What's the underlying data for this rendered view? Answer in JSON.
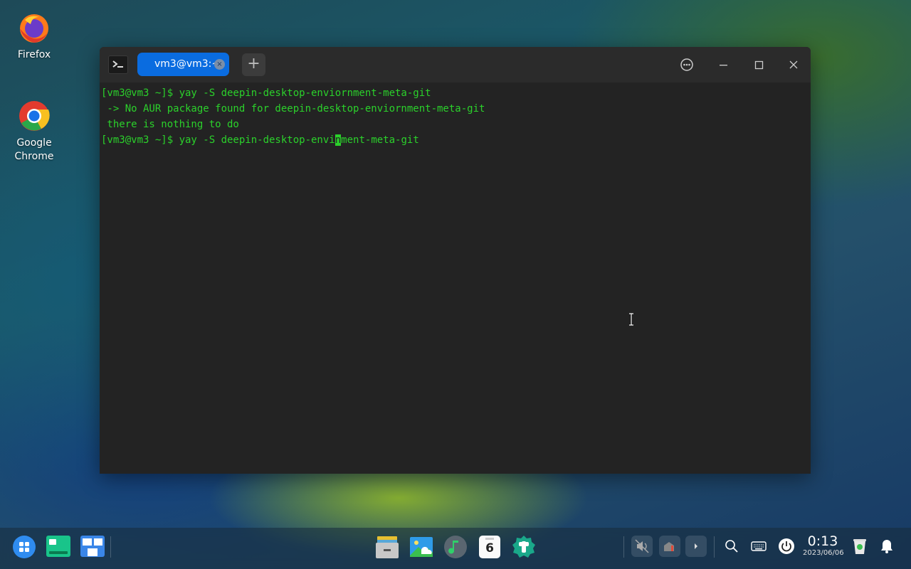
{
  "desktop": {
    "icons": [
      {
        "label": "Firefox",
        "icon": "firefox-icon"
      },
      {
        "label": "Google\nChrome",
        "line1": "Google",
        "line2": "Chrome",
        "icon": "chrome-icon"
      }
    ]
  },
  "terminal": {
    "tab_label": "vm3@vm3:~",
    "tab_close": "×",
    "new_tab": "+",
    "lines": [
      "[vm3@vm3 ~]$ yay -S deepin-desktop-enviornment-meta-git",
      " -> No AUR package found for deepin-desktop-enviornment-meta-git",
      " there is nothing to do"
    ],
    "current_before": "[vm3@vm3 ~]$ yay -S deepin-desktop-envi",
    "current_cursor": "n",
    "current_after": "ment-meta-git"
  },
  "taskbar": {
    "time": "0:13",
    "date": "2023/06/06",
    "calendar_day": "6"
  },
  "colors": {
    "accent": "#0a6ce0",
    "terminal_text": "#2bd12b",
    "terminal_bg": "#232323"
  }
}
